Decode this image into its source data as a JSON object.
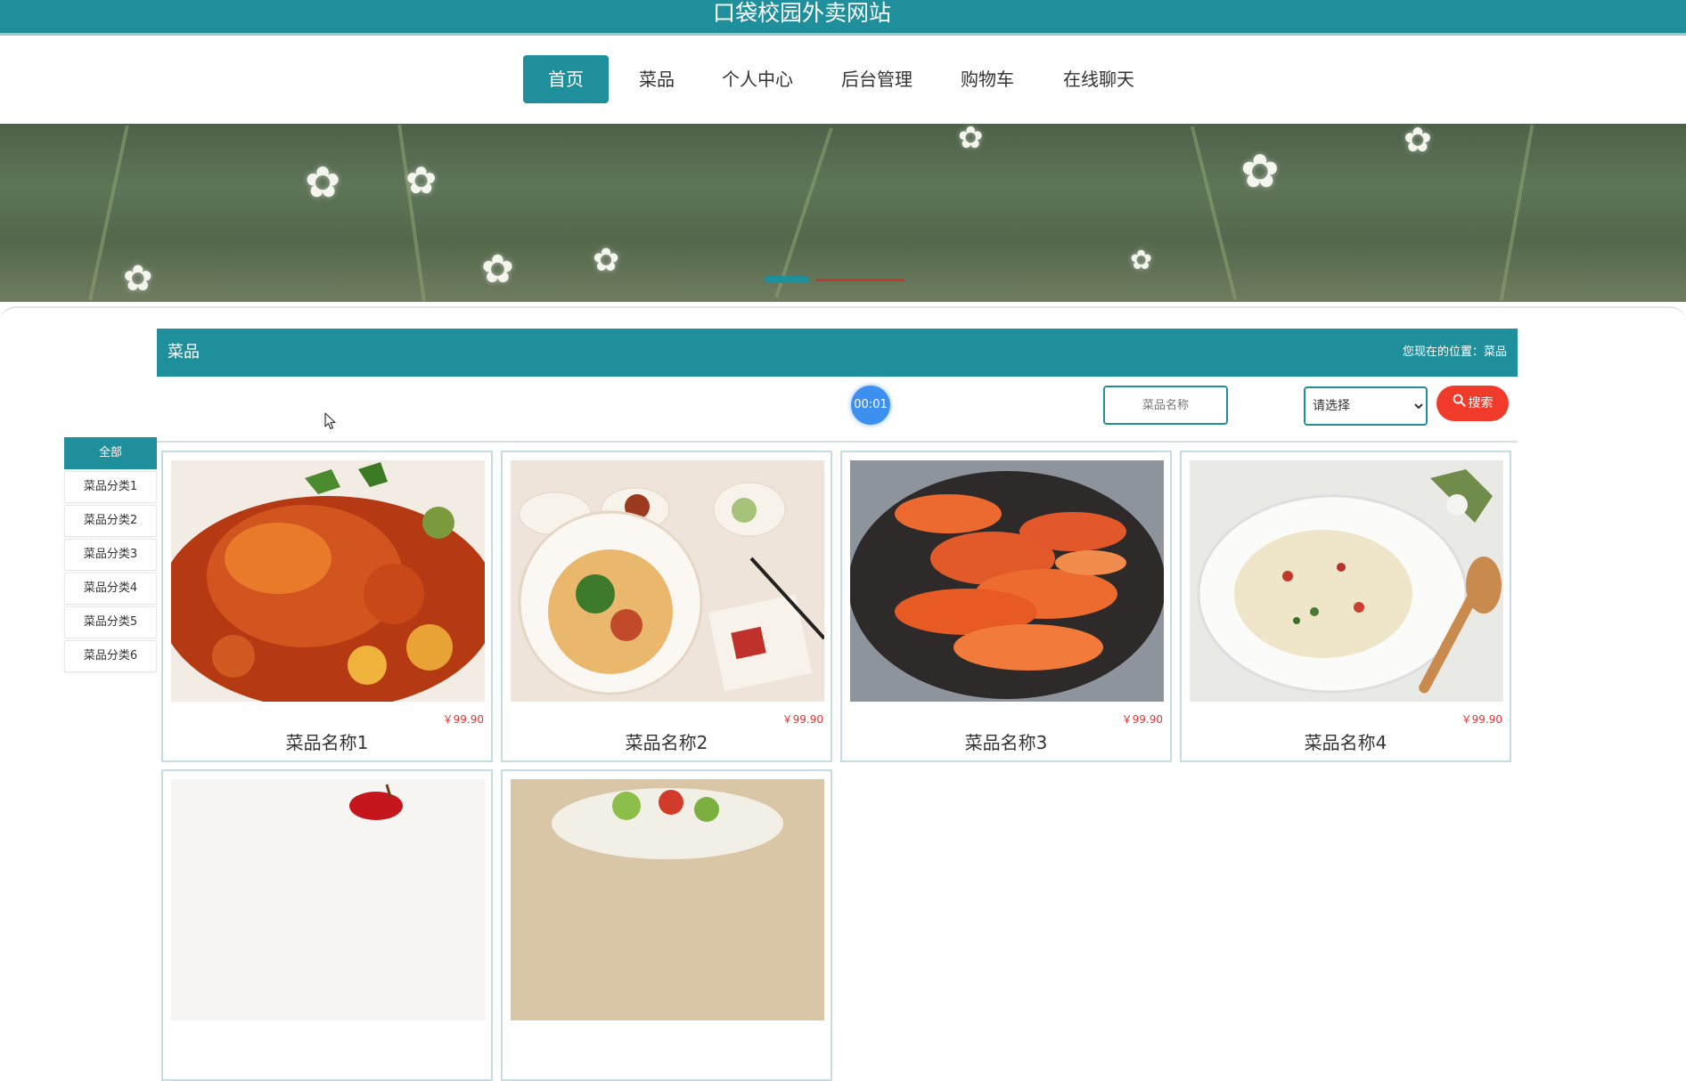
{
  "site": {
    "title": "口袋校园外卖网站"
  },
  "nav": {
    "items": [
      {
        "label": "首页",
        "active": true
      },
      {
        "label": "菜品"
      },
      {
        "label": "个人中心"
      },
      {
        "label": "后台管理"
      },
      {
        "label": "购物车"
      },
      {
        "label": "在线聊天"
      }
    ]
  },
  "section": {
    "title": "菜品",
    "breadcrumb": "您现在的位置：菜品"
  },
  "timer": {
    "label": "00:01"
  },
  "search": {
    "name_placeholder": "菜品名称",
    "select_value": "请选择",
    "button_label": "搜索",
    "icon": "search-icon"
  },
  "sidebar": {
    "items": [
      {
        "label": "全部",
        "active": true
      },
      {
        "label": "菜品分类1"
      },
      {
        "label": "菜品分类2"
      },
      {
        "label": "菜品分类3"
      },
      {
        "label": "菜品分类4"
      },
      {
        "label": "菜品分类5"
      },
      {
        "label": "菜品分类6"
      }
    ]
  },
  "products": [
    {
      "name": "菜品名称1",
      "price": "￥99.90",
      "image": "spicy-crab-dish"
    },
    {
      "name": "菜品名称2",
      "price": "￥99.90",
      "image": "noodle-bowl-set"
    },
    {
      "name": "菜品名称3",
      "price": "￥99.90",
      "image": "braised-shrimp-plate"
    },
    {
      "name": "菜品名称4",
      "price": "￥99.90",
      "image": "seafood-porridge"
    },
    {
      "name": "",
      "price": "",
      "image": "partial-card-5"
    },
    {
      "name": "",
      "price": "",
      "image": "partial-card-6"
    }
  ],
  "colors": {
    "primary": "#1f8f9b",
    "accent": "#f03a2a",
    "price": "#e23535",
    "timer": "#3d8ff0"
  }
}
